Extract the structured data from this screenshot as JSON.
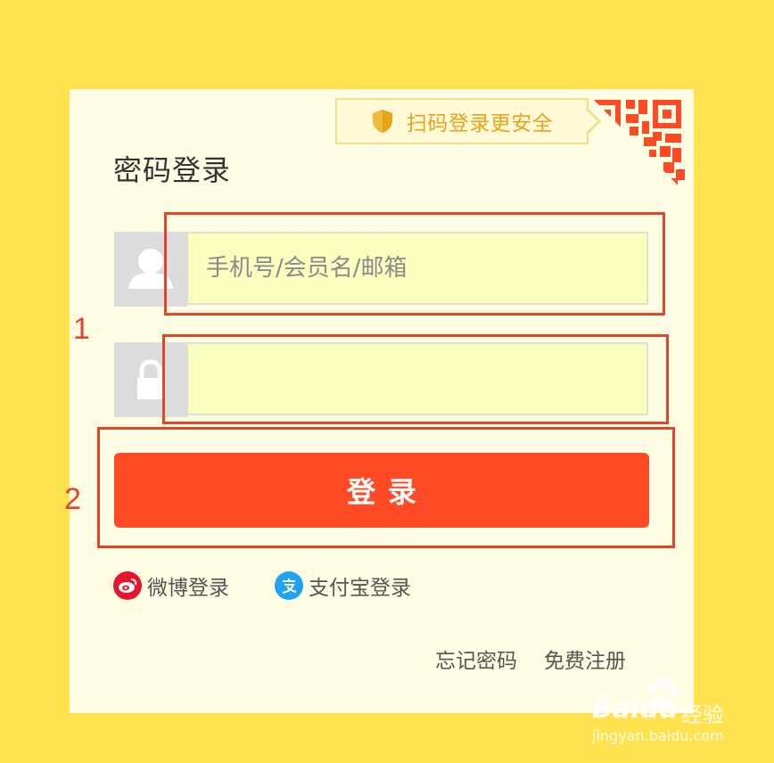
{
  "qr_tip": {
    "icon": "shield-icon",
    "text": "扫码登录更安全"
  },
  "title": "密码登录",
  "username": {
    "icon": "user-icon",
    "placeholder": "手机号/会员名/邮箱",
    "value": ""
  },
  "password": {
    "icon": "lock-icon",
    "placeholder": "",
    "value": ""
  },
  "login_button": "登录",
  "social": [
    {
      "icon": "weibo-icon",
      "label": "微博登录",
      "color": "#E6162D"
    },
    {
      "icon": "alipay-icon",
      "label": "支付宝登录",
      "color": "#1FA3F0"
    }
  ],
  "links": {
    "forgot_password": "忘记密码",
    "register": "免费注册"
  },
  "annotations": [
    "1",
    "2"
  ],
  "watermark": {
    "brand": "Baidu",
    "brand_cn": "经验",
    "url": "jingyan.baidu.com"
  },
  "colors": {
    "background": "#FFE24D",
    "panel": "#FFFCE4",
    "accent": "#FF4A26",
    "annotation": "#E2452B",
    "input_bg": "#FAFFBD",
    "tip_text": "#E8A419"
  }
}
